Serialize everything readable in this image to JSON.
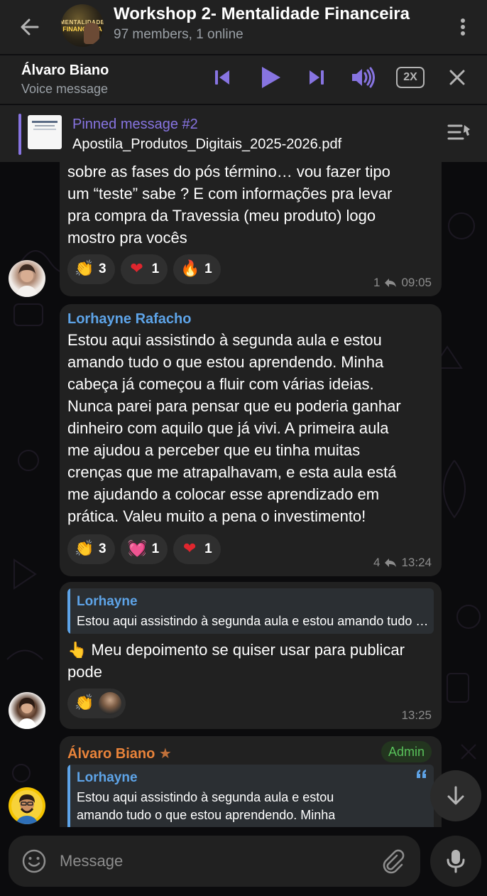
{
  "header": {
    "title": "Workshop 2- Mentalidade Financeira",
    "subtitle": "97 members, 1 online",
    "avatar_line1": "MENTALIDADE",
    "avatar_line2": "FINANCEIRA"
  },
  "player": {
    "name": "Álvaro Biano",
    "type": "Voice message",
    "speed": "2X"
  },
  "pinned": {
    "title": "Pinned message #2",
    "file": "Apostila_Produtos_Digitais_2025-2026.pdf"
  },
  "messages": [
    {
      "lines": [
        "sobre as fases do pós término… vou fazer tipo",
        "um “teste” sabe ? E com informações pra levar",
        "pra compra da Travessia (meu produto) logo",
        "mostro pra vocês"
      ],
      "reactions": [
        {
          "emoji": "👏",
          "count": "3"
        },
        {
          "emoji": "❤",
          "count": "1"
        },
        {
          "emoji": "🔥",
          "count": "1"
        }
      ],
      "replies": "1",
      "time": "09:05"
    },
    {
      "sender": "Lorhayne Rafacho",
      "lines": [
        "Estou aqui assistindo à segunda aula e estou",
        "amando tudo o que estou aprendendo. Minha",
        "cabeça já começou a fluir com várias ideias.",
        "Nunca parei para pensar que eu poderia ganhar",
        "dinheiro com aquilo que já vivi. A primeira aula",
        "me ajudou a perceber que eu tinha muitas",
        "crenças que me atrapalhavam, e esta aula está",
        "me ajudando a colocar esse aprendizado em",
        "prática. Valeu muito a pena o investimento!"
      ],
      "reactions": [
        {
          "emoji": "👏",
          "count": "3"
        },
        {
          "emoji": "💓",
          "count": "1"
        },
        {
          "emoji": "❤",
          "count": "1"
        }
      ],
      "replies": "4",
      "time": "13:24"
    },
    {
      "reply_name": "Lorhayne",
      "reply_text": "Estou aqui assistindo à segunda aula e estou amando tudo o que estou aprendendo.",
      "lines": [
        "👆 Meu depoimento se quiser usar para publicar",
        "pode"
      ],
      "reaction_emoji": "👏",
      "time": "13:25"
    },
    {
      "sender": "Álvaro Biano",
      "sender_star": "★",
      "badge": "Admin",
      "reply_name": "Lorhayne",
      "reply_line1": "Estou aqui assistindo à segunda aula e estou",
      "reply_line2": "amando tudo o que estou aprendendo. Minha"
    }
  ],
  "composer": {
    "placeholder": "Message"
  },
  "colors": {
    "accent": "#8774e1",
    "reply_blue": "#5ea4e8",
    "sender_orange": "#e8833a",
    "admin_green": "#58c05a",
    "bubble": "#212121"
  }
}
